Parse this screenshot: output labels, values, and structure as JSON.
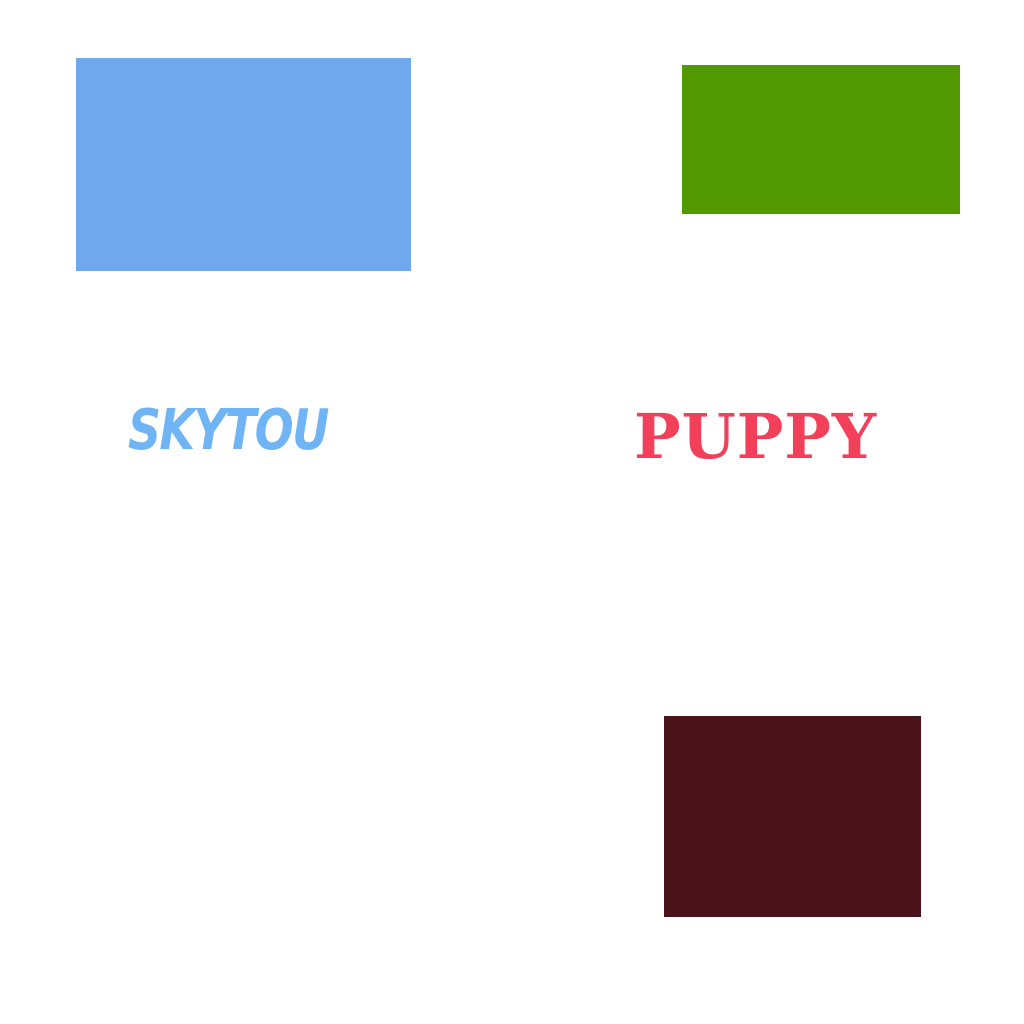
{
  "canvas": {
    "background": "#ffffff"
  },
  "blocks": [
    {
      "id": "blue",
      "color": "#6fa8ec"
    },
    {
      "id": "green",
      "color": "#539a02"
    },
    {
      "id": "maroon",
      "color": "#4a131a"
    }
  ],
  "words": {
    "skytou": {
      "text": "SKYTOU",
      "color": "#6fb5f5"
    },
    "puppy": {
      "text": "PUPPY",
      "color": "#f2405a"
    }
  }
}
